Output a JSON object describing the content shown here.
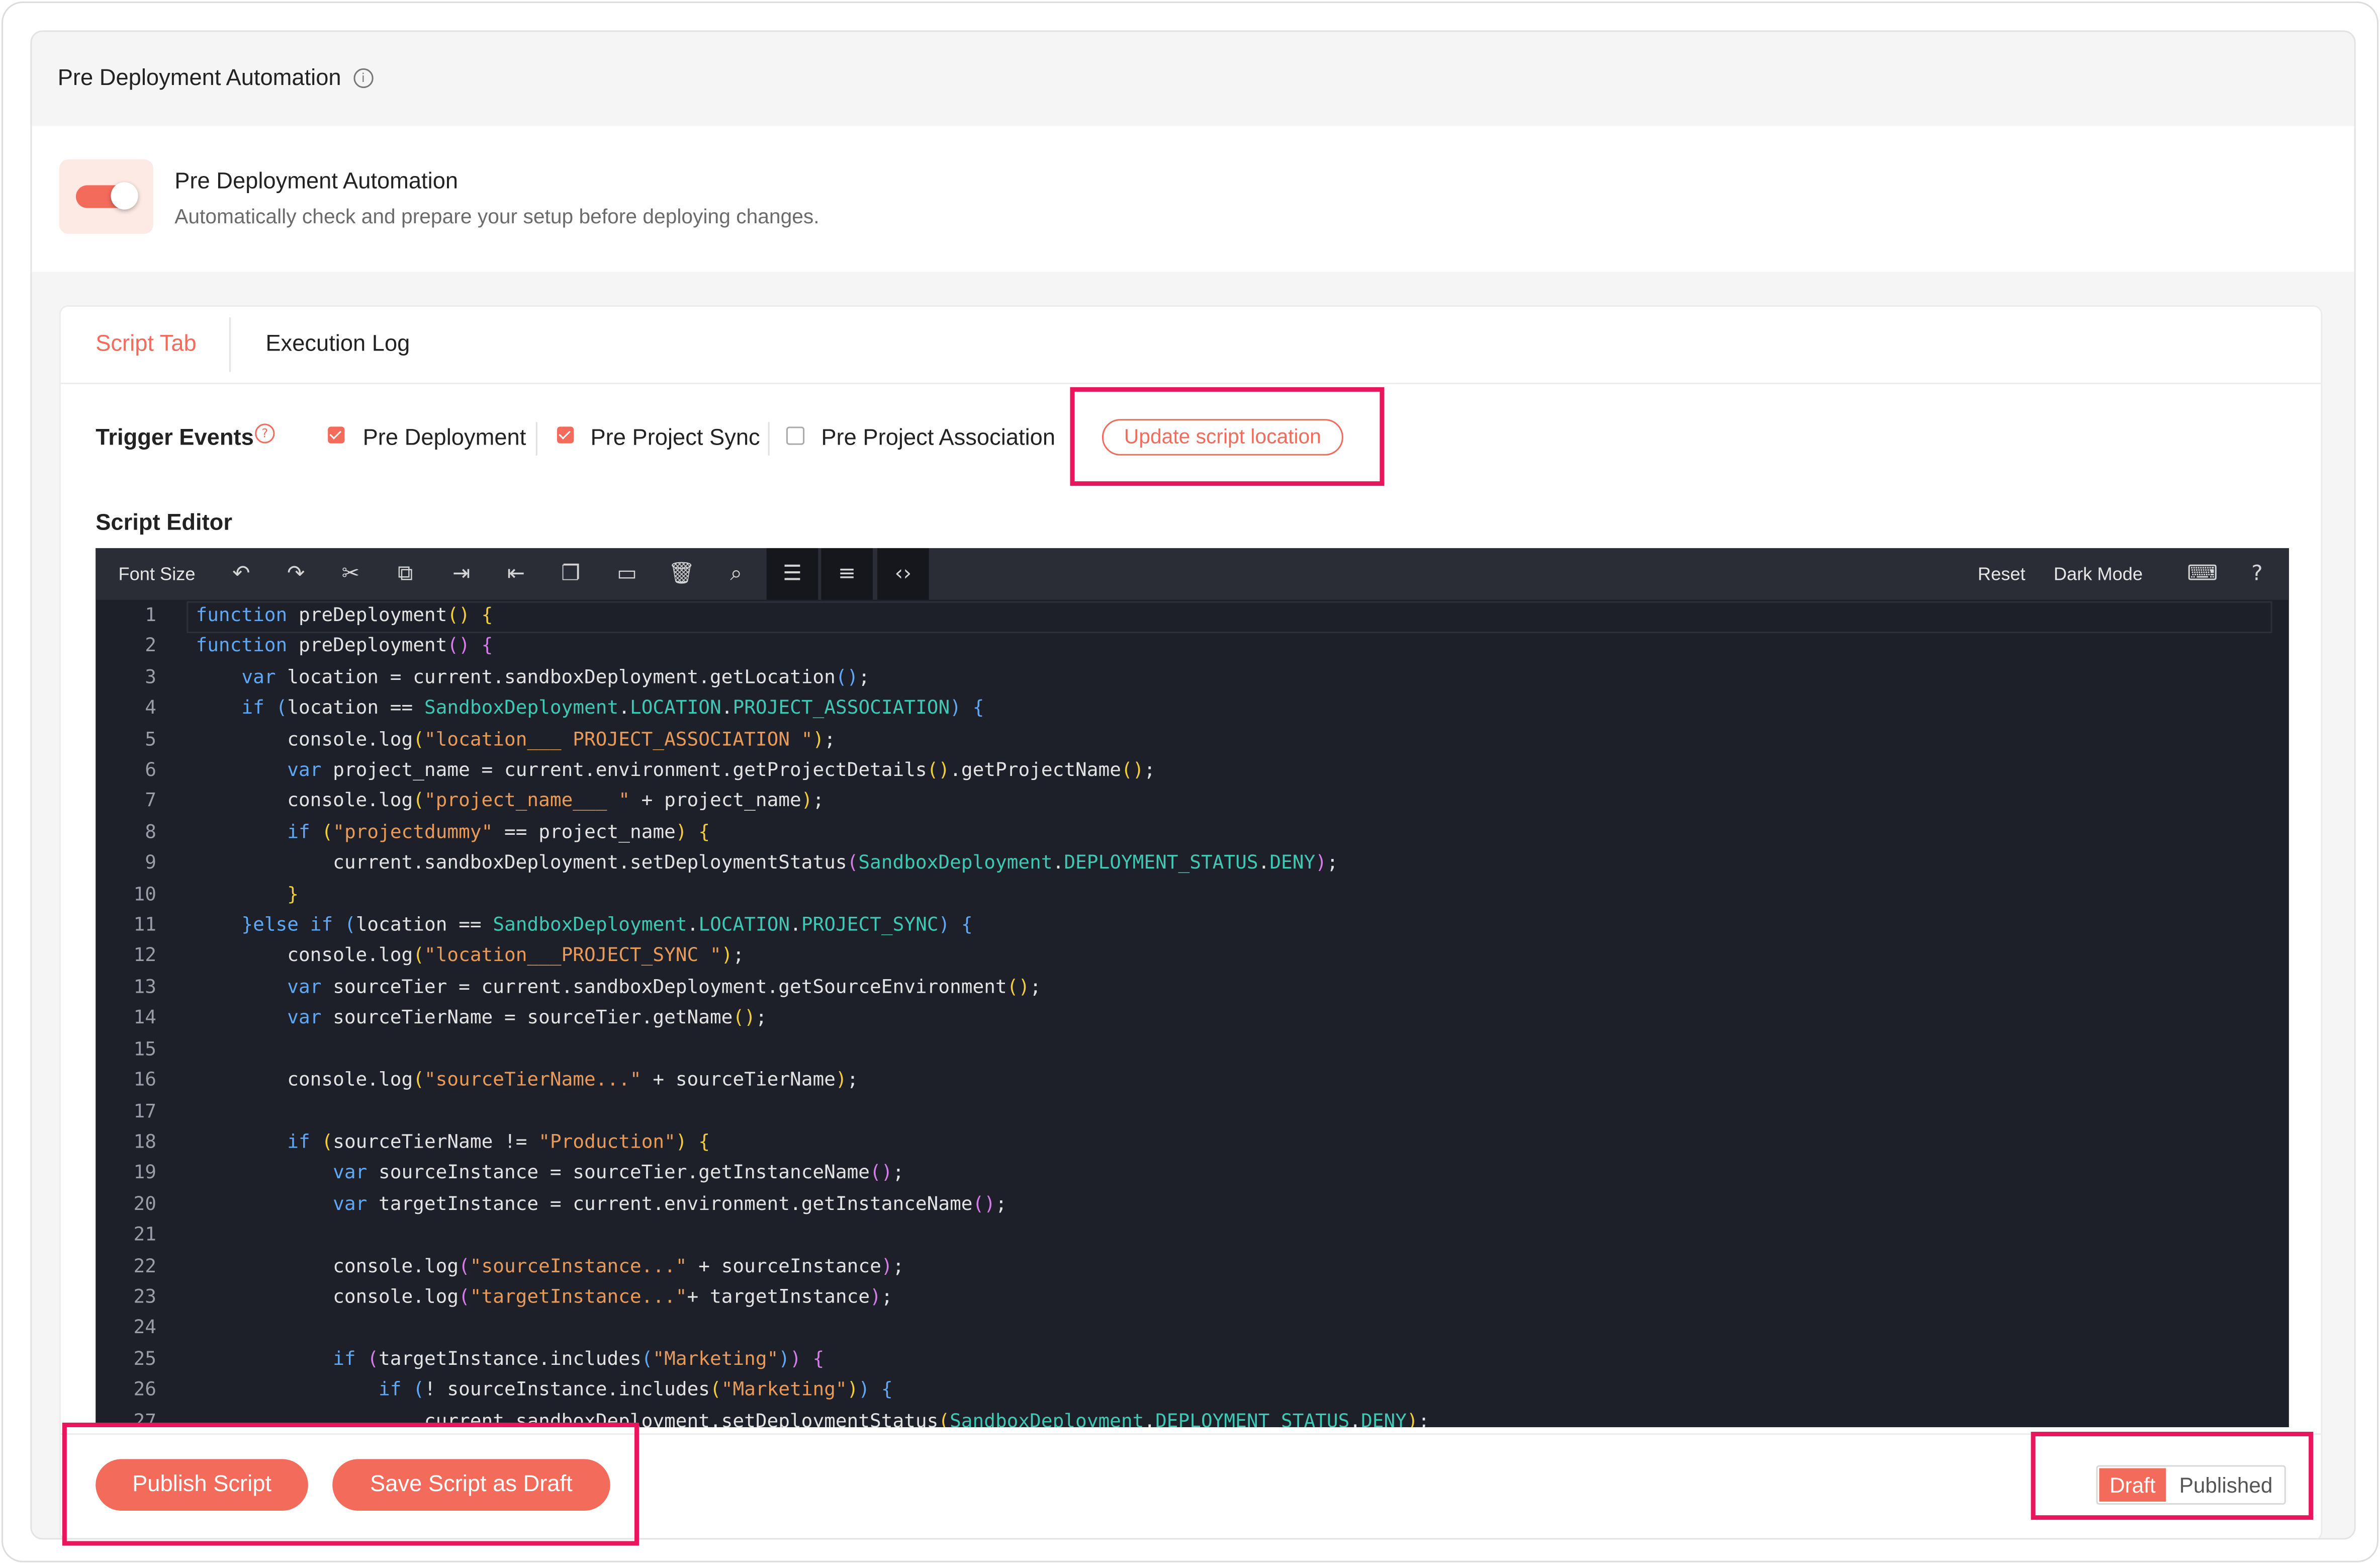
{
  "panel": {
    "title": "Pre Deployment Automation"
  },
  "automation": {
    "enabled": true,
    "title": "Pre Deployment Automation",
    "description": "Automatically check and prepare your setup before deploying changes."
  },
  "tabs": [
    {
      "label": "Script Tab",
      "active": true
    },
    {
      "label": "Execution Log",
      "active": false
    }
  ],
  "triggers": {
    "label": "Trigger Events",
    "events": [
      {
        "label": "Pre Deployment",
        "checked": true
      },
      {
        "label": "Pre Project Sync",
        "checked": true
      },
      {
        "label": "Pre Project Association",
        "checked": false
      }
    ],
    "update_label": "Update script location"
  },
  "editor": {
    "label": "Script Editor",
    "toolbar": {
      "font_size_label": "Font Size",
      "reset_label": "Reset",
      "dark_mode_label": "Dark Mode",
      "icons": [
        "undo-icon",
        "redo-icon",
        "cut-icon",
        "copy-icon",
        "indent-icon",
        "outdent-icon",
        "duplicate-icon",
        "comment-icon",
        "delete-icon",
        "find-replace-icon",
        "align-icon",
        "line-numbers-icon",
        "format-code-icon",
        "keyboard-icon",
        "help-icon"
      ]
    },
    "code_lines": [
      "function preDeployment() {",
      "function preDeployment() {",
      "    var location = current.sandboxDeployment.getLocation();",
      "    if (location == SandboxDeployment.LOCATION.PROJECT_ASSOCIATION) {",
      "        console.log(\"location___ PROJECT_ASSOCIATION \");",
      "        var project_name = current.environment.getProjectDetails().getProjectName();",
      "        console.log(\"project_name___ \" + project_name);",
      "        if (\"projectdummy\" == project_name) {",
      "            current.sandboxDeployment.setDeploymentStatus(SandboxDeployment.DEPLOYMENT_STATUS.DENY);",
      "        }",
      "    }else if (location == SandboxDeployment.LOCATION.PROJECT_SYNC) {",
      "        console.log(\"location___PROJECT_SYNC \");",
      "        var sourceTier = current.sandboxDeployment.getSourceEnvironment();",
      "        var sourceTierName = sourceTier.getName();",
      "",
      "        console.log(\"sourceTierName...\" + sourceTierName);",
      "",
      "        if (sourceTierName != \"Production\") {",
      "            var sourceInstance = sourceTier.getInstanceName();",
      "            var targetInstance = current.environment.getInstanceName();",
      "",
      "            console.log(\"sourceInstance...\" + sourceInstance);",
      "            console.log(\"targetInstance...\"+ targetInstance);",
      "",
      "            if (targetInstance.includes(\"Marketing\")) {",
      "                if (! sourceInstance.includes(\"Marketing\")) {",
      "                    current.sandboxDeployment.setDeploymentStatus(SandboxDeployment.DEPLOYMENT_STATUS.DENY);"
    ]
  },
  "actions": {
    "publish_label": "Publish Script",
    "save_draft_label": "Save Script as Draft"
  },
  "status": {
    "draft_label": "Draft",
    "published_label": "Published",
    "selected": "Draft"
  },
  "colors": {
    "accent": "#f26b5b",
    "highlight_border": "#e8175d",
    "editor_bg": "#1e2029"
  }
}
